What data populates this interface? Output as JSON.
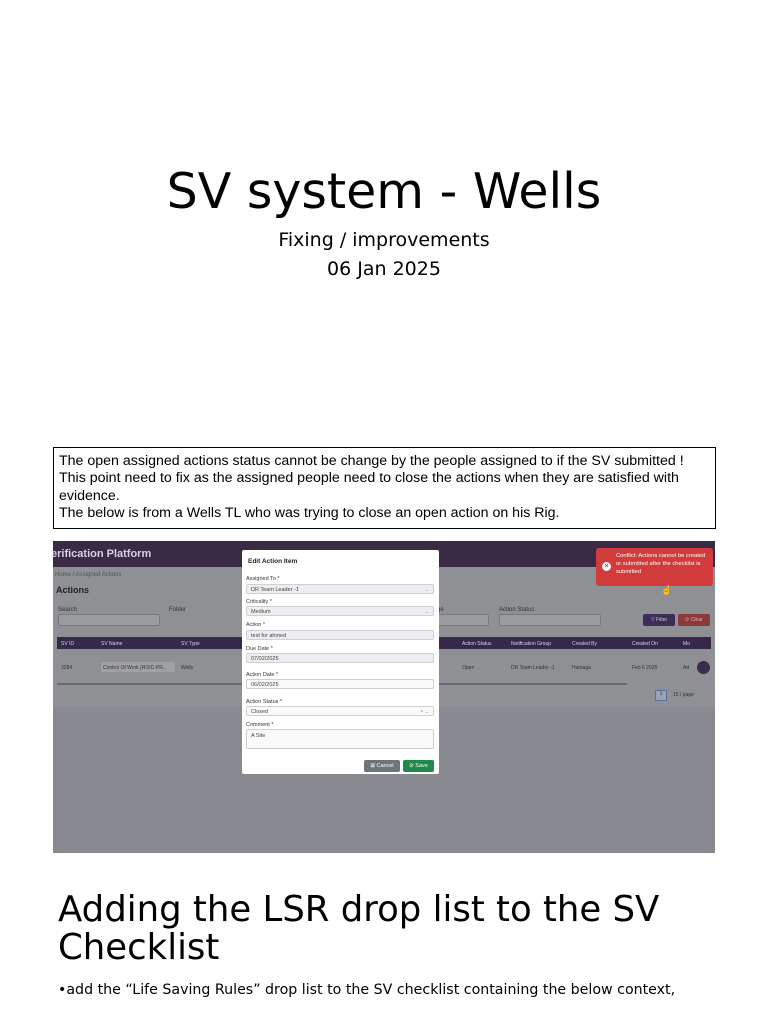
{
  "title": "SV system - Wells",
  "subtitle": "Fixing / improvements",
  "date": "06 Jan 2025",
  "note": {
    "line1": "The open assigned actions status cannot be change by the people assigned to if the SV submitted !",
    "line2": "This point need to fix as the assigned people need to close the actions when they are satisfied with evidence.",
    "line3": "The below is from a Wells TL who was trying to close an open action on his Rig."
  },
  "screenshot": {
    "brand": "erification Platform",
    "breadcrumb": "Home  /  Assigned Actions",
    "page_heading": "Actions",
    "filters": {
      "search": "Search",
      "folder": "Folder",
      "stage": "ge",
      "action_status": "Action Status"
    },
    "buttons": {
      "filter": "▽ Filter",
      "clear": "⟳ Clear"
    },
    "table_headers": [
      "SV ID",
      "SV Name",
      "SV Type",
      "Action Status",
      "Notification Group",
      "Created By",
      "Created On",
      "Mo"
    ],
    "row": {
      "sv_id": "3284",
      "sv_name": "Control Of Work (ROIC-PR...",
      "sv_type": "Wells",
      "action_status": "Open",
      "notification_group": "DR Team Leader -1",
      "created_by": "Hamaga",
      "created_on": "Feb 6 2025",
      "more": "Ad"
    },
    "pager": {
      "page": "1",
      "per_page": "15 / page"
    },
    "conflict_message": "Conflict: Actions cannot be created or submitted after the checklist is submitted",
    "modal": {
      "title": "Edit Action Item",
      "assigned_to_label": "Assigned To *",
      "assigned_to_value": "DR Team Leader -1",
      "criticality_label": "Criticality *",
      "criticality_value": "Medium",
      "action_label": "Action *",
      "action_value": "test for ahmed",
      "due_date_label": "Due Date *",
      "due_date_value": "07/02/2025",
      "action_date_label": "Action Date *",
      "action_date_value": "06/02/2025",
      "action_status_label": "Action Status *",
      "action_status_value": "Closed",
      "comment_label": "Comment *",
      "comment_value": "A Site",
      "cancel_label": "⊠ Cancel",
      "save_label": "⊘ Save"
    },
    "colors": {
      "topbar": "#3a2a45",
      "conflict": "#d23b3b",
      "save": "#1f8a4c",
      "cancel": "#6c757d"
    }
  },
  "section_heading": "Adding the LSR drop list to the SV Checklist",
  "bullet": "•add the “Life Saving Rules” drop list to the SV checklist containing the below context,"
}
